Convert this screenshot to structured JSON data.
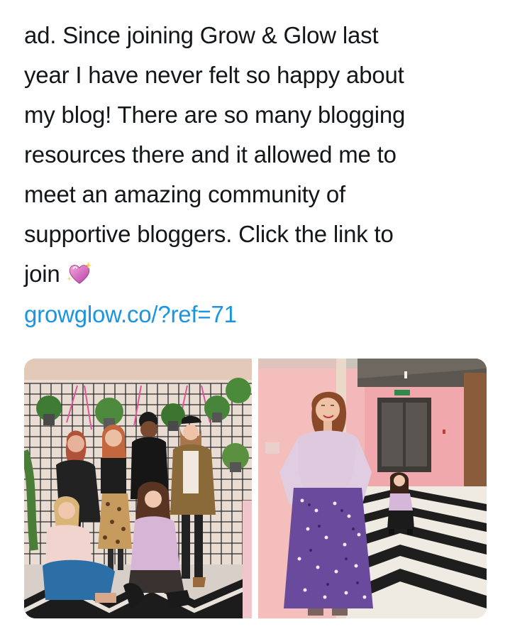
{
  "tweet": {
    "text": "ad. Since joining Grow & Glow last\nyear I have never felt so happy about\nmy blog! There are so many blogging\nresources there and it allowed me to\nmeet an amazing community of\nsupportive bloggers. Click the link to\njoin",
    "emoji": "sparkling-heart-icon",
    "link": "growglow.co/?ref=71"
  },
  "media": {
    "photos": [
      {
        "name": "group-photo",
        "scene": "six women posing in front of wall grid with hanging plants"
      },
      {
        "name": "hallway-photo",
        "scene": "woman in lilac top and purple skirt in pink hallway with chevron floor"
      }
    ]
  },
  "colors": {
    "text": "#14171a",
    "link": "#1b95e0",
    "background": "#ffffff"
  }
}
